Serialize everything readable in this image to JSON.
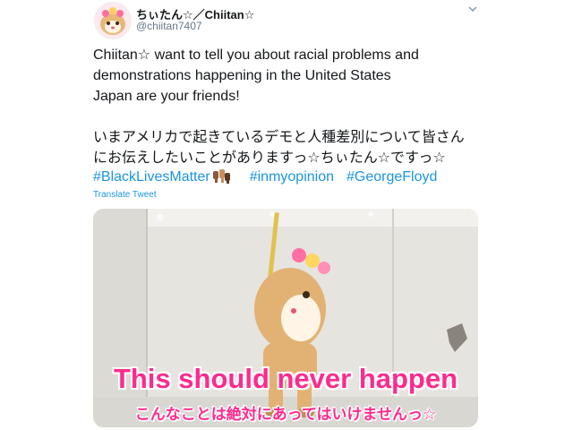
{
  "author": {
    "display_name": "ちぃたん☆／Chiitan☆",
    "handle": "@chiitan7407",
    "avatar_icon": "mascot-avatar-icon"
  },
  "more_icon": "chevron-down-icon",
  "tweet": {
    "lines_en": [
      "Chiitan☆ want to tell you about racial problems and",
      "demonstrations happening in the United States",
      "Japan are your friends!"
    ],
    "lines_ja": [
      "いまアメリカで起きているデモと人種差別について皆さん",
      "にお伝えしたいことがありますっ☆ちぃたん☆ですっ☆"
    ],
    "hashtags": [
      "#BlackLivesMatter",
      "#inmyopinion",
      "#GeorgeFloyd"
    ],
    "fist_emoji_icon": "raised-fists-icon",
    "translate_label": "Translate Tweet"
  },
  "media": {
    "caption_en": "This should never happen",
    "caption_ja": "こんなことは絶対にあってはいけませんっ☆",
    "caption_color": "#ff2a8d"
  },
  "colors": {
    "link": "#1b95e0",
    "text": "#14171a",
    "secondary": "#657786"
  }
}
